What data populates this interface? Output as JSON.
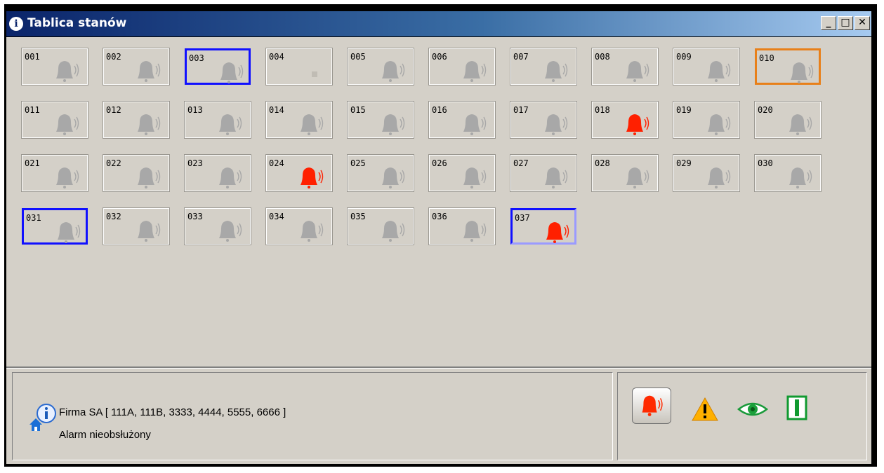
{
  "window": {
    "title": "Tablica stanów"
  },
  "title_buttons": {
    "minimize": "_",
    "maximize": "□",
    "close": "✕"
  },
  "tiles": [
    {
      "n": "001",
      "state": "grey"
    },
    {
      "n": "002",
      "state": "grey"
    },
    {
      "n": "003",
      "state": "grey",
      "sel": "blue"
    },
    {
      "n": "004",
      "state": "empty"
    },
    {
      "n": "005",
      "state": "grey"
    },
    {
      "n": "006",
      "state": "grey"
    },
    {
      "n": "007",
      "state": "grey"
    },
    {
      "n": "008",
      "state": "grey"
    },
    {
      "n": "009",
      "state": "grey"
    },
    {
      "n": "010",
      "state": "grey",
      "sel": "orange"
    },
    {
      "n": "011",
      "state": "grey"
    },
    {
      "n": "012",
      "state": "grey"
    },
    {
      "n": "013",
      "state": "grey"
    },
    {
      "n": "014",
      "state": "grey"
    },
    {
      "n": "015",
      "state": "grey"
    },
    {
      "n": "016",
      "state": "grey"
    },
    {
      "n": "017",
      "state": "grey"
    },
    {
      "n": "018",
      "state": "alarm"
    },
    {
      "n": "019",
      "state": "grey"
    },
    {
      "n": "020",
      "state": "grey"
    },
    {
      "n": "021",
      "state": "grey"
    },
    {
      "n": "022",
      "state": "grey"
    },
    {
      "n": "023",
      "state": "grey"
    },
    {
      "n": "024",
      "state": "alarm"
    },
    {
      "n": "025",
      "state": "grey"
    },
    {
      "n": "026",
      "state": "grey"
    },
    {
      "n": "027",
      "state": "grey"
    },
    {
      "n": "028",
      "state": "grey"
    },
    {
      "n": "029",
      "state": "grey"
    },
    {
      "n": "030",
      "state": "grey"
    },
    {
      "n": "031",
      "state": "grey",
      "sel": "blue"
    },
    {
      "n": "032",
      "state": "grey"
    },
    {
      "n": "033",
      "state": "grey"
    },
    {
      "n": "034",
      "state": "grey"
    },
    {
      "n": "035",
      "state": "grey"
    },
    {
      "n": "036",
      "state": "grey"
    },
    {
      "n": "037",
      "state": "alarm",
      "sel": "light"
    }
  ],
  "info": {
    "object_line": "Firma SA [ 111A, 111B, 3333, 4444, 5555, 6666 ]",
    "status_line": "Alarm nieobsłużony"
  },
  "status_icons": [
    "alarm-bell-icon",
    "warning-icon",
    "eye-icon",
    "door-icon"
  ],
  "colors": {
    "alarm": "#ff2000",
    "bell_grey": "#a8a8a8",
    "select_blue": "#1010ff",
    "select_orange": "#e8801a"
  }
}
